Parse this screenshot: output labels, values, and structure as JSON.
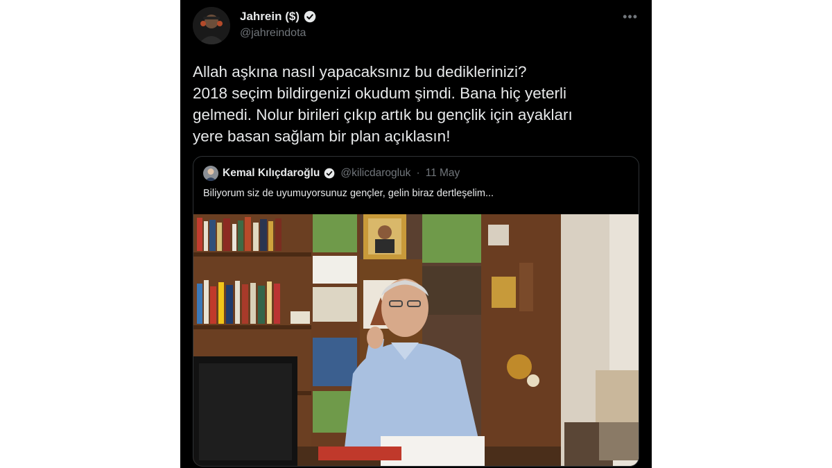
{
  "author": {
    "display_name": "Jahrein ($)",
    "handle": "@jahreindota",
    "avatar_icon": "avatar-icon",
    "verified_icon": "verified-badge-icon"
  },
  "tweet": {
    "lines": [
      "Allah aşkına nasıl yapacaksınız bu dediklerinizi?",
      "2018 seçim bildirgenizi okudum şimdi. Bana hiç yeterli",
      "gelmedi. Nolur birileri çıkıp artık bu gençlik için ayakları",
      "yere basan sağlam bir plan açıklasın!"
    ]
  },
  "quoted_tweet": {
    "display_name": "Kemal Kılıçdaroğlu",
    "handle": "@kilicdarogluk",
    "separator": "·",
    "date": "11 May",
    "text": "Biliyorum siz de uyumuyorsunuz gençler, gelin biraz dertleşelim...",
    "media_icon": "video-thumbnail"
  },
  "menu": {
    "more_label": "•••"
  },
  "colors": {
    "background": "#000000",
    "text_primary": "#e7e9ea",
    "text_secondary": "#71767b",
    "border": "#2f3336",
    "verified": "#e7e9ea"
  }
}
